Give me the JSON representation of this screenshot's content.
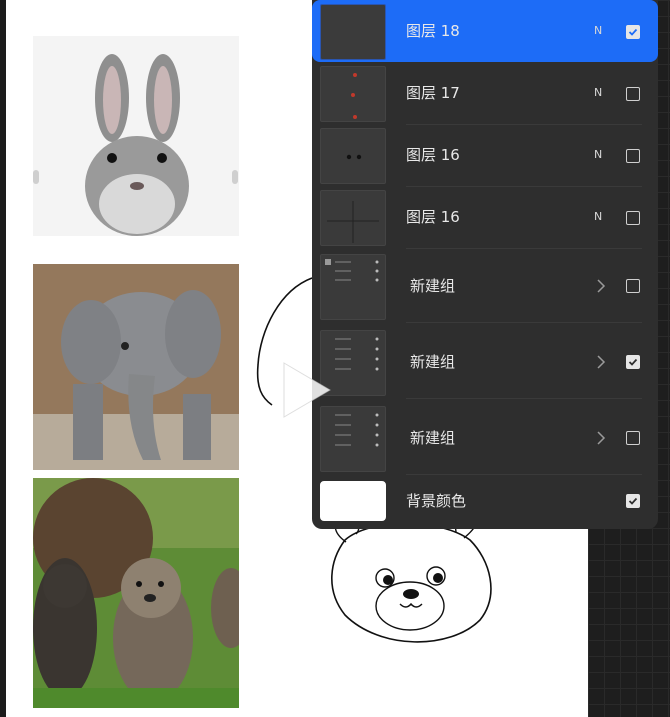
{
  "layers_panel": {
    "layers": [
      {
        "name": "图层 18",
        "blend": "N",
        "visible": true,
        "selected": true
      },
      {
        "name": "图层 17",
        "blend": "N",
        "visible": false,
        "selected": false
      },
      {
        "name": "图层 16",
        "blend": "N",
        "visible": false,
        "selected": false
      },
      {
        "name": "图层 16",
        "blend": "N",
        "visible": false,
        "selected": false
      }
    ],
    "groups": [
      {
        "name": "新建组",
        "visible": false
      },
      {
        "name": "新建组",
        "visible": true
      },
      {
        "name": "新建组",
        "visible": false
      }
    ],
    "background": {
      "name": "背景颜色",
      "visible": true,
      "color": "#ffffff"
    }
  },
  "reference_images": [
    "rabbit",
    "elephant",
    "bear-cubs"
  ],
  "accent_color": "#1d6cf7",
  "icons": [
    "play-icon",
    "chevron-right-icon",
    "checkbox-icon"
  ]
}
